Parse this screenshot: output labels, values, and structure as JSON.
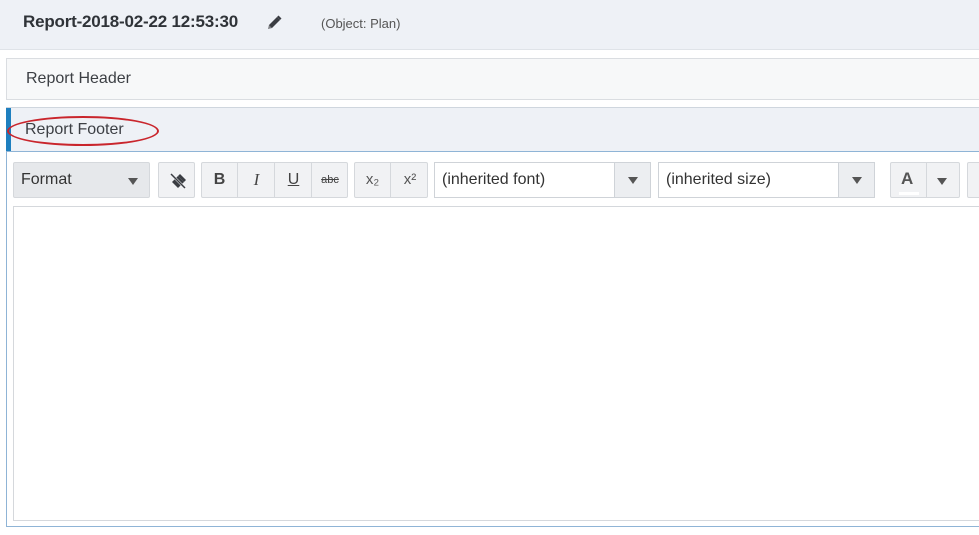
{
  "header": {
    "title": "Report-2018-02-22 12:53:30",
    "edit_icon": "pencil-icon",
    "object_label": "(Object: Plan)"
  },
  "sections": {
    "report_header": "Report Header",
    "report_footer": "Report Footer"
  },
  "toolbar": {
    "format_label": "Format",
    "remove_format_icon": "eraser-icon",
    "bold": "B",
    "italic": "I",
    "underline": "U",
    "strikethrough": "abc",
    "subscript": "x₂",
    "superscript": "x²",
    "font_value": "(inherited font)",
    "size_value": "(inherited size)",
    "text_color": "A"
  },
  "colors": {
    "accent": "#1e7fbf",
    "annotation": "#c9252c"
  }
}
